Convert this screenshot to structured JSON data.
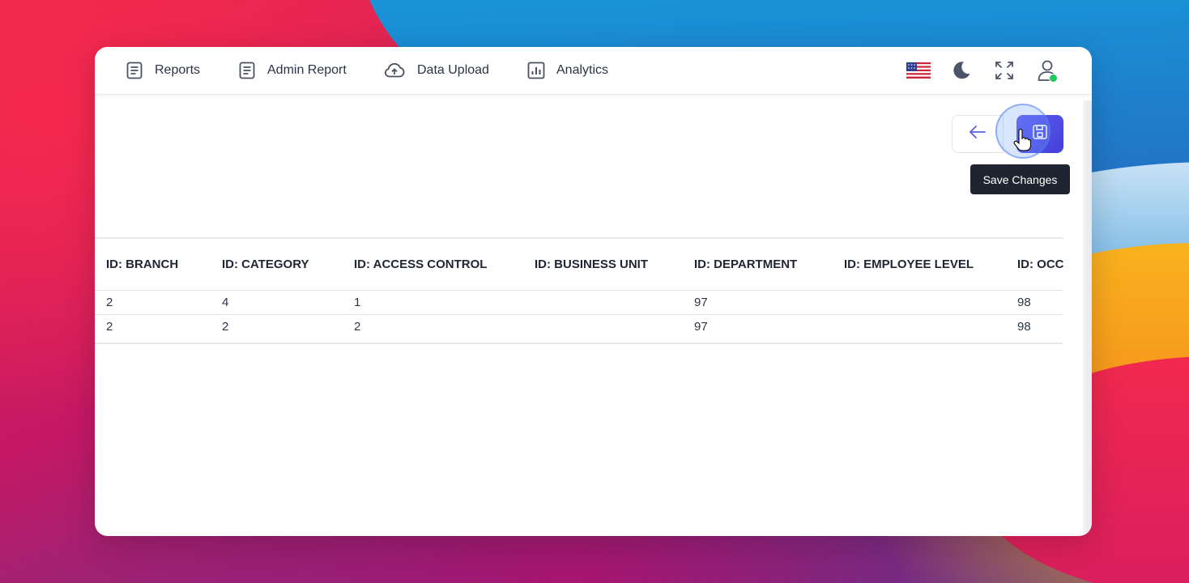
{
  "nav": {
    "items": [
      {
        "label": "Reports",
        "icon": "document-icon"
      },
      {
        "label": "Admin Report",
        "icon": "document-icon"
      },
      {
        "label": "Data Upload",
        "icon": "cloud-upload-icon"
      },
      {
        "label": "Analytics",
        "icon": "bar-chart-icon"
      }
    ]
  },
  "topbar": {
    "icons": [
      "us-flag-icon",
      "moon-icon",
      "fullscreen-icon",
      "user-icon"
    ],
    "status_color": "#22c55e"
  },
  "actions": {
    "back_icon": "arrow-left-icon",
    "save_icon": "floppy-disk-icon",
    "tooltip": "Save Changes",
    "accent": "#4f4de6"
  },
  "table": {
    "columns": [
      "ID: BRANCH",
      "ID: CATEGORY",
      "ID: ACCESS CONTROL",
      "ID: BUSINESS UNIT",
      "ID: DEPARTMENT",
      "ID: EMPLOYEE LEVEL",
      "ID: OCC"
    ],
    "rows": [
      [
        "2",
        "4",
        "1",
        "",
        "97",
        "",
        "98"
      ],
      [
        "2",
        "2",
        "2",
        "",
        "97",
        "",
        "98"
      ]
    ]
  }
}
